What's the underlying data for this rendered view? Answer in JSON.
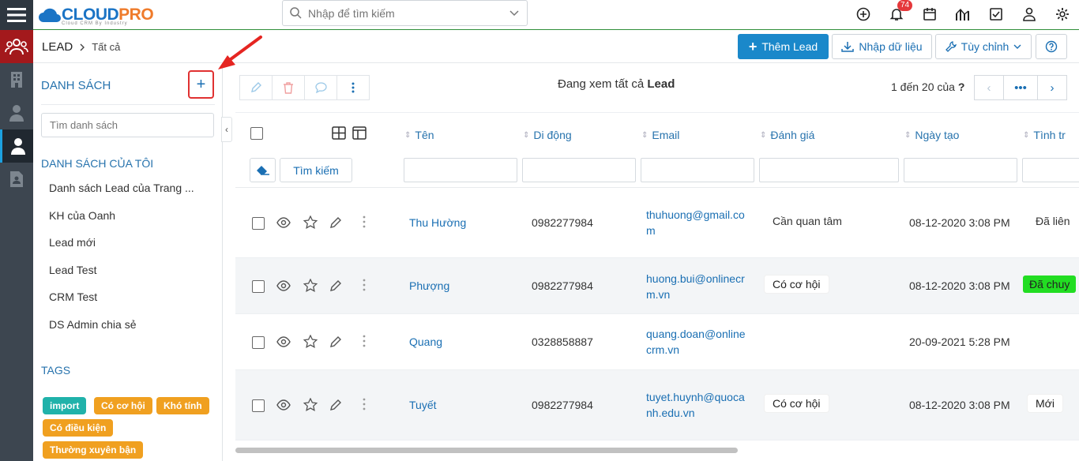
{
  "app": {
    "logo_text_1": "CLOUD",
    "logo_text_2": "PRO",
    "logo_sub": "Cloud CRM By Industry"
  },
  "topbar": {
    "search_placeholder": "Nhập để tìm kiếm",
    "notifications_count": "74"
  },
  "breadcrumb": {
    "module": "LEAD",
    "view": "Tất cả"
  },
  "toolbar": {
    "add_label": "Thêm Lead",
    "import_label": "Nhập dữ liệu",
    "customize_label": "Tùy chỉnh"
  },
  "sidebar": {
    "title": "DANH SÁCH",
    "search_placeholder": "Tìm danh sách",
    "my_lists_title": "DANH SÁCH CỦA TÔI",
    "items": [
      {
        "label": "Danh sách Lead của Trang ..."
      },
      {
        "label": "KH của Oanh"
      },
      {
        "label": "Lead mới"
      },
      {
        "label": "Lead Test"
      },
      {
        "label": "CRM Test"
      },
      {
        "label": "DS Admin chia sẻ"
      }
    ],
    "tags_title": "TAGS",
    "tags": [
      {
        "label": "import",
        "color": "#20b2aa"
      },
      {
        "label": "Có cơ hội",
        "color": "#f0a020"
      },
      {
        "label": "Khó tính",
        "color": "#f0a020"
      },
      {
        "label": "Có điều kiện",
        "color": "#f0a020"
      },
      {
        "label": "Thường xuyên bận",
        "color": "#f0a020"
      }
    ]
  },
  "main": {
    "viewing_prefix": "Đang xem tất cả",
    "viewing_module": "Lead",
    "pager_text": "1 đến 20 của",
    "pager_q": "?",
    "search_button": "Tìm kiếm",
    "columns": [
      "Tên",
      "Di động",
      "Email",
      "Đánh giá",
      "Ngày tạo",
      "Tình tr"
    ],
    "rows": [
      {
        "name": "Thu Hường",
        "phone": "0982277984",
        "email_1": "thuhuong@gmail.co",
        "email_2": "m",
        "rating": "Cần quan tâm",
        "created": "08-12-2020 3:08 PM",
        "status": "Đã liên"
      },
      {
        "name": "Phượng",
        "phone": "0982277984",
        "email_1": "huong.bui@onlinecr",
        "email_2": "m.vn",
        "rating": "Có cơ hội",
        "created": "08-12-2020 3:08 PM",
        "status": "Đã chuy"
      },
      {
        "name": "Quang",
        "phone": "0328858887",
        "email_1": "quang.doan@online",
        "email_2": "crm.vn",
        "rating": "",
        "created": "20-09-2021 5:28 PM",
        "status": ""
      },
      {
        "name": "Tuyết",
        "phone": "0982277984",
        "email_1": "tuyet.huynh@quoca",
        "email_2": "nh.edu.vn",
        "rating": "Có cơ hội",
        "created": "08-12-2020 3:08 PM",
        "status": "Mới"
      }
    ]
  },
  "colors": {
    "primary": "#1a88ca",
    "brand_orange": "#ef7b2b",
    "leftbar": "#3d4650",
    "leftbar_active_red": "#a3191c",
    "status_green": "#22dd22",
    "highlight_red": "#e03131"
  }
}
